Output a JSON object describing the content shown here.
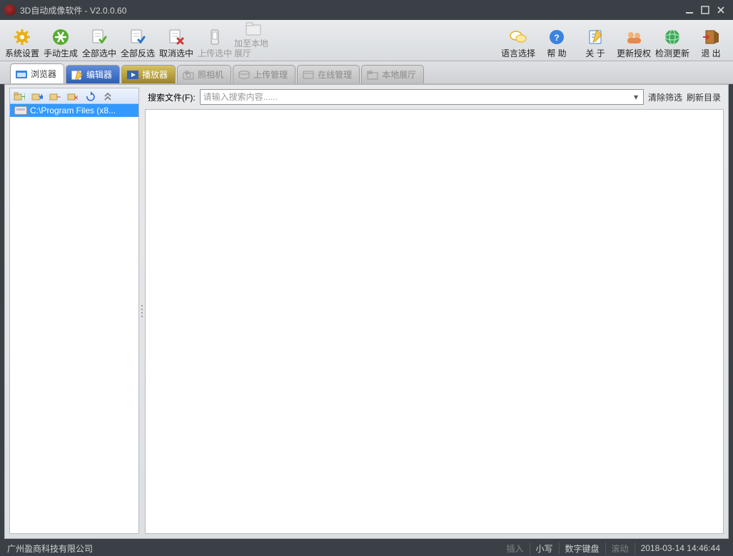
{
  "title": "3D自动成像软件 - V2.0.0.60",
  "toolbarLeft": [
    {
      "name": "settings",
      "label": "系统设置",
      "icon": "gear",
      "color": "#e8b013"
    },
    {
      "name": "manual-gen",
      "label": "手动生成",
      "icon": "asterisk",
      "color": "#56ad2c"
    },
    {
      "name": "select-all",
      "label": "全部选中",
      "icon": "doccheck",
      "color": "#56ad2c"
    },
    {
      "name": "invert-select",
      "label": "全部反选",
      "icon": "doccheck",
      "color": "#2a72cc"
    },
    {
      "name": "deselect",
      "label": "取消选中",
      "icon": "docx",
      "color": "#cc3a3a"
    },
    {
      "name": "upload-sel",
      "label": "上传选中",
      "icon": "phone",
      "color": "#9a9a9a",
      "disabled": true
    },
    {
      "name": "add-local",
      "label": "加至本地展厅",
      "icon": "localgallery",
      "color": "#9a9a9a",
      "disabled": true
    }
  ],
  "toolbarRight": [
    {
      "name": "language",
      "label": "语言选择",
      "icon": "chat",
      "color": "#e8b013"
    },
    {
      "name": "help",
      "label": "帮 助",
      "icon": "help",
      "color": "#2a72cc"
    },
    {
      "name": "about",
      "label": "关 于",
      "icon": "note",
      "color": "#2a72cc"
    },
    {
      "name": "relicense",
      "label": "更新授权",
      "icon": "people",
      "color": "#e7894a"
    },
    {
      "name": "check-update",
      "label": "检测更新",
      "icon": "globe",
      "color": "#3fa85a"
    },
    {
      "name": "exit",
      "label": "退 出",
      "icon": "door",
      "color": "#a06a2e"
    }
  ],
  "tabs": [
    {
      "name": "browser",
      "label": "浏览器",
      "cls": "active"
    },
    {
      "name": "editor",
      "label": "编辑器",
      "cls": "blue"
    },
    {
      "name": "player",
      "label": "播放器",
      "cls": "gold"
    },
    {
      "name": "camera",
      "label": "照相机",
      "cls": "disabled"
    },
    {
      "name": "upload-mgr",
      "label": "上传管理",
      "cls": "disabled"
    },
    {
      "name": "online-mgr",
      "label": "在线管理",
      "cls": "disabled"
    },
    {
      "name": "local-gallery",
      "label": "本地展厅",
      "cls": "disabled"
    }
  ],
  "tree": {
    "selected": "C:\\Program Files (x8..."
  },
  "search": {
    "label": "搜索文件(F):",
    "placeholder": "请输入搜索内容......",
    "clear": "清除筛选",
    "refresh": "刷新目录"
  },
  "status": {
    "company": "广州盈商科技有限公司",
    "insert": "插入",
    "case": "小写",
    "numlock": "数字键盘",
    "scroll": "滚动",
    "datetime": "2018-03-14 14:46:44"
  }
}
